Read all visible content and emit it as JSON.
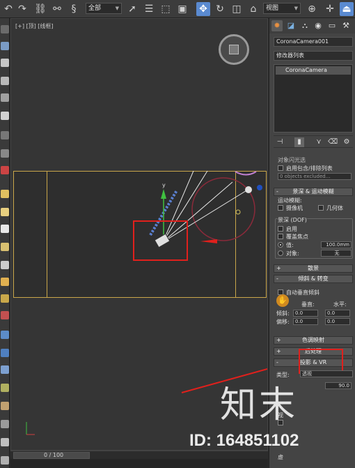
{
  "toolbar": {
    "filter_select": "全部",
    "ref_coord_select": "视图"
  },
  "viewport": {
    "label": "[+] [顶] [线框]",
    "axis_y": "y"
  },
  "timeline": {
    "frame": "0 / 100"
  },
  "panel": {
    "object_name": "CoronaCamera001",
    "modifier_list": "修改器列表",
    "stack_item": "CoronaCamera",
    "rollout_partial": "对象闪光选",
    "include_exclude_check": "启用包含/排除列表",
    "objects_excluded": "0 objects excluded...",
    "rollout_dof_mb": "景深 & 运动模糊",
    "motion_blur_group": "运动模糊:",
    "camera_check": "摄像机",
    "geometry_check": "几何体",
    "dof_group": "景深 (DOF)",
    "enable_check": "启用",
    "override_focus_check": "覆盖焦点",
    "value_label": "值:",
    "value_field": "100.0mm",
    "object_label": "对象:",
    "object_field": "无",
    "rollout_bokeh": "散景",
    "rollout_tilt_shift": "倾斜 & 转变",
    "auto_vertical_tilt": "自动垂直倾斜",
    "vertical_label": "垂直:",
    "horizontal_label": "水平:",
    "tilt_label": "倾斜:",
    "shift_label": "偏移:",
    "tilt_v": "0.0",
    "tilt_h": "0.0",
    "shift_v": "0.0",
    "shift_h": "0.0",
    "rollout_tone_mapping": "色调映射",
    "rollout_postprocess": "后处理",
    "rollout_projection_vr": "投影 & VR",
    "type_label": "类型:",
    "type_value": "透视",
    "fov_value": "90.0",
    "partial_label_1": "视",
    "partial_label_2": "虚"
  },
  "watermark": {
    "site": "知末",
    "id": "ID: 164851102"
  },
  "colors": {
    "highlight_box": "#e0201c",
    "active_tool": "#5a8ad0",
    "safe_frame": "#c9a64a"
  }
}
